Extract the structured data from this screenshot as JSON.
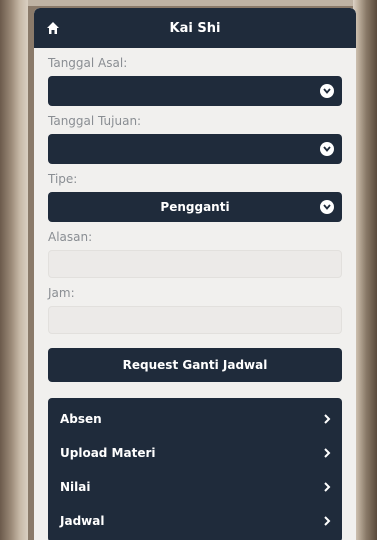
{
  "header": {
    "title": "Kai Shi"
  },
  "form": {
    "tanggal_asal_label": "Tanggal Asal:",
    "tanggal_asal_value": "",
    "tanggal_tujuan_label": "Tanggal Tujuan:",
    "tanggal_tujuan_value": "",
    "tipe_label": "Tipe:",
    "tipe_value": "Pengganti",
    "alasan_label": "Alasan:",
    "alasan_value": "",
    "jam_label": "Jam:",
    "jam_value": "",
    "submit_label": "Request Ganti Jadwal"
  },
  "menu": {
    "items": [
      {
        "label": "Absen"
      },
      {
        "label": "Upload Materi"
      },
      {
        "label": "Nilai"
      },
      {
        "label": "Jadwal"
      }
    ]
  },
  "colors": {
    "primary": "#1f2b3b",
    "background": "#f1f0ee",
    "label": "#8a8e93"
  },
  "icons": {
    "home": "home-icon",
    "dropdown": "chevron-down-icon",
    "menu_arrow": "chevron-right-icon"
  }
}
